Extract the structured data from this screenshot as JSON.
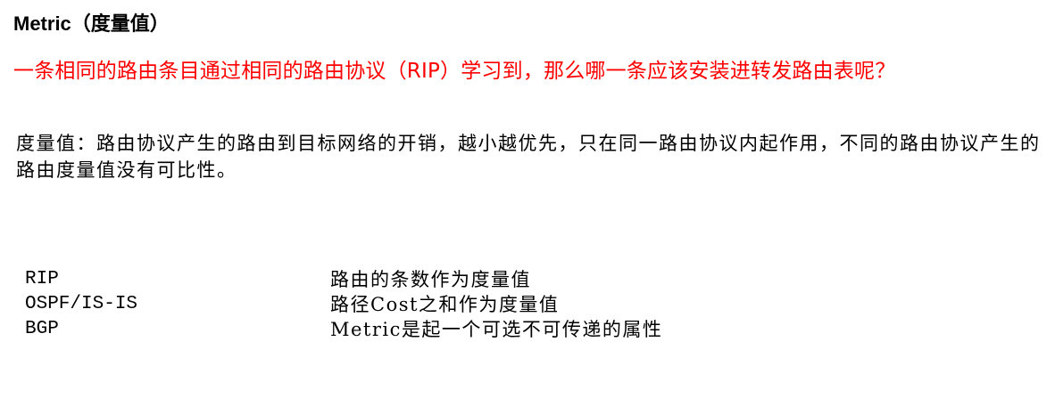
{
  "title": "Metric（度量值）",
  "question": "一条相同的路由条目通过相同的路由协议（RIP）学习到，那么哪一条应该安装进转发路由表呢？",
  "definition": "度量值：路由协议产生的路由到目标网络的开销，越小越优先，只在同一路由协议内起作用，不同的路由协议产生的路由度量值没有可比性。",
  "metrics": [
    {
      "protocol": "RIP",
      "description": "路由的条数作为度量值"
    },
    {
      "protocol": "OSPF/IS-IS",
      "description": "路径Cost之和作为度量值"
    },
    {
      "protocol": "BGP",
      "description": "Metric是起一个可选不可传递的属性"
    }
  ],
  "colors": {
    "question": "#ff0000",
    "text": "#000000",
    "background": "#ffffff"
  }
}
